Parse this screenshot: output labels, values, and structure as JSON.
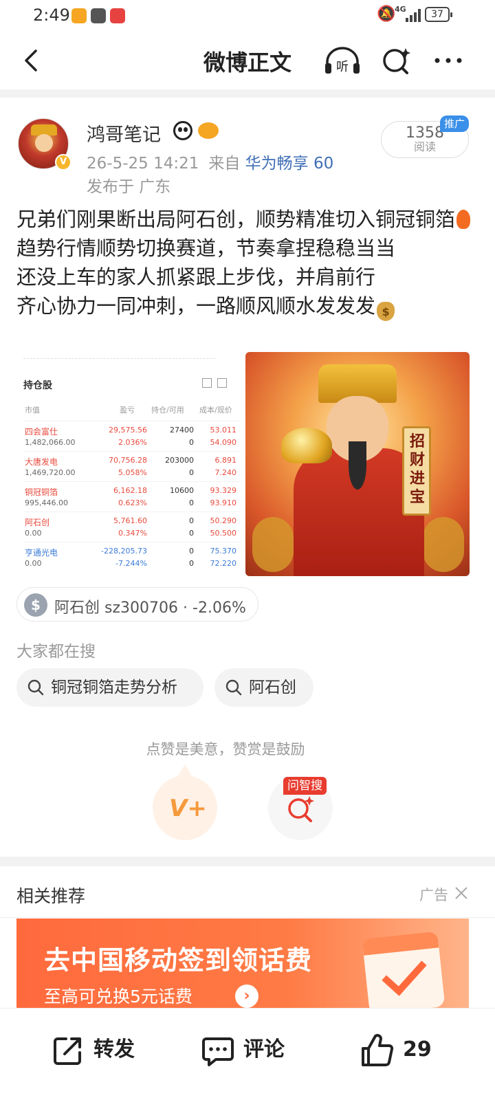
{
  "status_bar": {
    "time": "2:49",
    "network": "4G",
    "battery": "37"
  },
  "nav": {
    "title": "微博正文",
    "listen_icon_text": "听"
  },
  "author": {
    "name": "鸿哥笔记",
    "verified_badge": "V",
    "timestamp": "26-5-25 14:21",
    "source_prefix": "来自",
    "device": "华为畅享 60",
    "location": "发布于 广东",
    "reads": "1358",
    "reads_label": "阅读",
    "promo_tag": "推广"
  },
  "post": {
    "lines": [
      "兄弟们刚果断出局阿石创，顺势精准切入铜冠铜箔",
      "趋势行情顺势切换赛道，节奏拿捏稳稳当当",
      "还没上车的家人抓紧跟上步伐，并肩前行",
      "齐心协力一同冲刺，一路顺风顺水发发发"
    ]
  },
  "holdings": {
    "title": "持仓股",
    "columns": [
      "市值",
      "盈亏",
      "持仓/可用",
      "成本/现价"
    ],
    "rows": [
      {
        "name": "四会富仕",
        "market_value": "1,482,066.00",
        "pl": "29,575.56",
        "pl_ratio": "2.036%",
        "qty": "27400",
        "avail": "0",
        "cost": "53.011",
        "price": "54.090",
        "color": "red"
      },
      {
        "name": "大唐发电",
        "market_value": "1,469,720.00",
        "pl": "70,756.28",
        "pl_ratio": "5.058%",
        "qty": "203000",
        "avail": "0",
        "cost": "6.891",
        "price": "7.240",
        "color": "red"
      },
      {
        "name": "铜冠铜箔",
        "market_value": "995,446.00",
        "pl": "6,162.18",
        "pl_ratio": "0.623%",
        "qty": "10600",
        "avail": "0",
        "cost": "93.329",
        "price": "93.910",
        "color": "red"
      },
      {
        "name": "阿石创",
        "market_value": "0.00",
        "pl": "5,761.60",
        "pl_ratio": "0.347%",
        "qty": "0",
        "avail": "0",
        "cost": "50.290",
        "price": "50.500",
        "color": "red"
      },
      {
        "name": "亨通光电",
        "market_value": "0.00",
        "pl": "-228,205.73",
        "pl_ratio": "-7.244%",
        "qty": "0",
        "avail": "0",
        "cost": "75.370",
        "price": "72.220",
        "color": "blue"
      }
    ]
  },
  "caishen_scroll": "招财进宝",
  "stock": {
    "name": "阿石创",
    "code": "sz300706",
    "separator": "·",
    "change": "-2.06%"
  },
  "search": {
    "heading": "大家都在搜",
    "chips": [
      "铜冠铜箔走势分析",
      "阿石创"
    ]
  },
  "reward": {
    "hint": "点赞是美意，赞赏是鼓励",
    "ask_label": "问智搜"
  },
  "related": {
    "title": "相关推荐",
    "ad_tag": "广告"
  },
  "ad": {
    "title": "去中国移动签到领话费",
    "subtitle": "至高可兑换5元话费"
  },
  "actions": {
    "repost": "转发",
    "comment": "评论",
    "like_count": "29"
  },
  "colors": {
    "accent_blue": "#3f6fb5",
    "promo_blue": "#3a8fe8",
    "gain_red": "#e84a3d",
    "loss_blue": "#3b7bd8",
    "ad_orange": "#ff6a3d"
  }
}
